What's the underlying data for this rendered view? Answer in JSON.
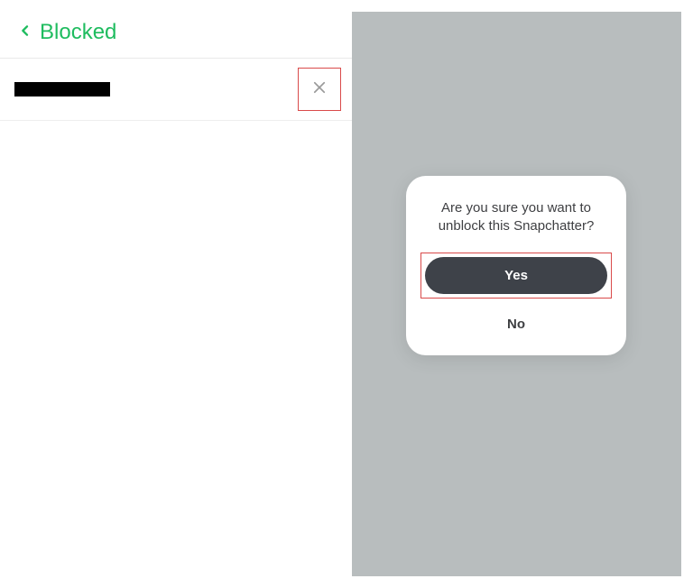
{
  "header": {
    "title": "Blocked"
  },
  "dialog": {
    "line1": "Are you sure you want to",
    "line2": "unblock this Snapchatter?",
    "yes": "Yes",
    "no": "No"
  }
}
